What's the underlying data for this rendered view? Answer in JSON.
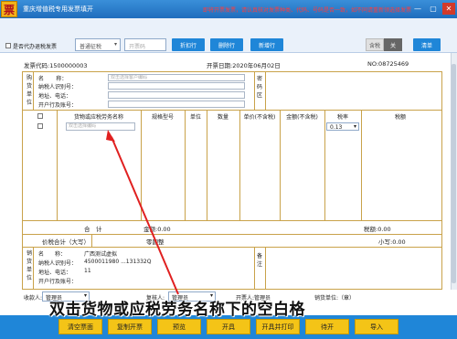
{
  "titlebar": {
    "title": "重庆增值税专用发票填开",
    "hint": "即将开票发票，请认真核对发票种类、代码、号码是否一致，如不同请重新领选择发票",
    "app_icon_text": "票",
    "minimize": "—",
    "maximize": "▢",
    "close": "✕"
  },
  "toolbar": {
    "checkbox_label": "是否代办退税发票",
    "tax_method_select": "普通征税",
    "price_input_placeholder": "开票码",
    "discount_button": "折扣行",
    "delete_button": "删除行",
    "add_button": "新增行",
    "toggle_on": "含税",
    "toggle_off": "关",
    "clear_button": "清单"
  },
  "invoice": {
    "code_label": "发票代码:1500000003",
    "date_label": "开票日期:2020年06月02日",
    "no_label": "NO:08725469",
    "buyer": {
      "side_label": [
        "购",
        "货",
        "单",
        "位"
      ],
      "name_label": "名",
      "name_full_label": "称：",
      "name_placeholder": "双击选择客户编码",
      "taxid_label": "纳税人识别号：",
      "addr_label": "地址、电话：",
      "bank_label": "开户行及账号：",
      "pwd_label": [
        "密",
        "码",
        "区"
      ]
    },
    "columns": {
      "name": "货物或应税劳务名称",
      "spec": "规格型号",
      "unit": "单位",
      "qty": "数量",
      "price": "单价(不含税)",
      "amount": "金额(不含税)",
      "rate": "税率",
      "tax": "税额"
    },
    "item_placeholder": "双击选择编码",
    "tax_rate_value": "0.13",
    "total_label": "合　计",
    "total_amount": "金额:0.00",
    "total_tax": "税额:0.00",
    "sum_label": "价税合计（大写）",
    "sum_upper": "零圆整",
    "sum_lower": "小写:0.00",
    "seller": {
      "side_label": [
        "销",
        "货",
        "单",
        "位"
      ],
      "name_label": "名　　称：",
      "name_value": "广西测试虚拟",
      "taxid_label": "纳税人识别号：",
      "taxid_value": "4500011980 ...131332Q",
      "addr_label": "地址、电话：",
      "addr_value": "11",
      "bank_label": "开户行及账号：",
      "remark_label": [
        "备",
        "注"
      ]
    }
  },
  "bottom": {
    "payee_label": "收款人:",
    "payee_value": "管理员",
    "reviewer_label": "复核人:",
    "reviewer_value": "管理员",
    "drawer_label": "开票人:管理员",
    "seller_unit_label": "销货单位:（章）"
  },
  "footer": {
    "buttons": [
      "清空票面",
      "复制开票",
      "预览",
      "开具",
      "开具并打印",
      "待开",
      "导入"
    ]
  },
  "overlay": {
    "caption": "双击货物或应税劳务名称下的空白格"
  },
  "colors": {
    "titlebar": "#1f6dbd",
    "button_blue": "#1f86d8",
    "footer_button": "#f4c417",
    "grid_line": "#c9a24a",
    "hint_red": "#ff3c3c",
    "arrow_red": "#e02020"
  }
}
